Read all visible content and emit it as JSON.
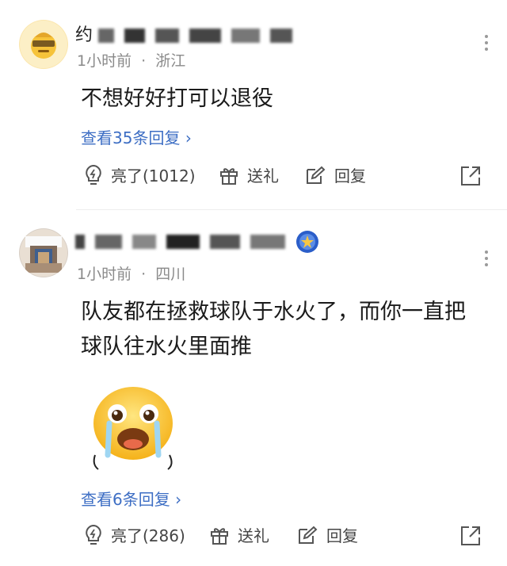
{
  "comments": [
    {
      "username_visible": "约",
      "time": "1小时前",
      "location": "浙江",
      "text_lines": [
        "不想好好打可以退役"
      ],
      "view_replies": "查看35条回复 ",
      "actions": {
        "like": "亮了(1012)",
        "gift": "送礼",
        "reply": "回复"
      },
      "icons": {
        "avatar": "emoji-cap-avatar",
        "like": "lightbulb-icon",
        "gift": "gift-icon",
        "reply": "pencil-icon",
        "share": "share-icon",
        "more": "more-vertical-icon"
      }
    },
    {
      "username_visible": "",
      "time": "1小时前",
      "location": "四川",
      "text_lines": [
        "队友都在拯救球队于水火了，而你一直把",
        "球队往水火里面推"
      ],
      "view_replies": "查看6条回复 ",
      "actions": {
        "like": "亮了(286)",
        "gift": "送礼",
        "reply": "回复"
      },
      "icons": {
        "avatar": "photo-avatar",
        "badge": "star-badge-icon",
        "sticker": "crying-emoji-sticker",
        "like": "lightbulb-icon",
        "gift": "gift-icon",
        "reply": "pencil-icon",
        "share": "share-icon",
        "more": "more-vertical-icon"
      }
    }
  ],
  "colors": {
    "link": "#3d6ec4",
    "meta": "#8a8a8a",
    "text": "#1b1b1b",
    "icon": "#555555"
  }
}
